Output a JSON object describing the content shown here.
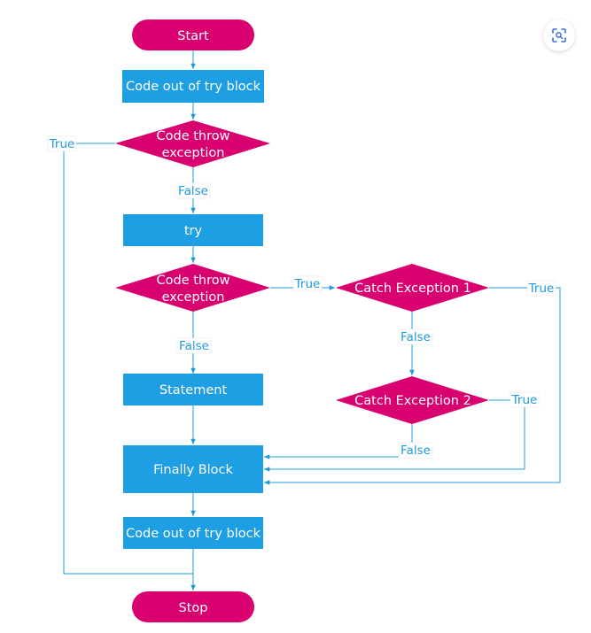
{
  "colors": {
    "terminal": "#d9006f",
    "process": "#1e9fe3",
    "decision": "#d9006f",
    "edge": "#1e9bd7"
  },
  "toolbar": {
    "zoom_icon": "focus-zoom-icon"
  },
  "nodes": {
    "start": "Start",
    "code_out_1": "Code out of try block",
    "decision_1": [
      "Code throw",
      "exception"
    ],
    "try": "try",
    "decision_2": [
      "Code throw",
      "exception"
    ],
    "catch_1": "Catch Exception 1",
    "catch_2": "Catch Exception 2",
    "statement": "Statement",
    "finally": "Finally Block",
    "code_out_2": "Code out of try block",
    "stop": "Stop"
  },
  "edge_labels": {
    "d1_true": "True",
    "d1_false": "False",
    "d2_true": "True",
    "d2_false": "False",
    "c1_true": "True",
    "c1_false": "False",
    "c2_true": "True",
    "c2_false": "False"
  }
}
